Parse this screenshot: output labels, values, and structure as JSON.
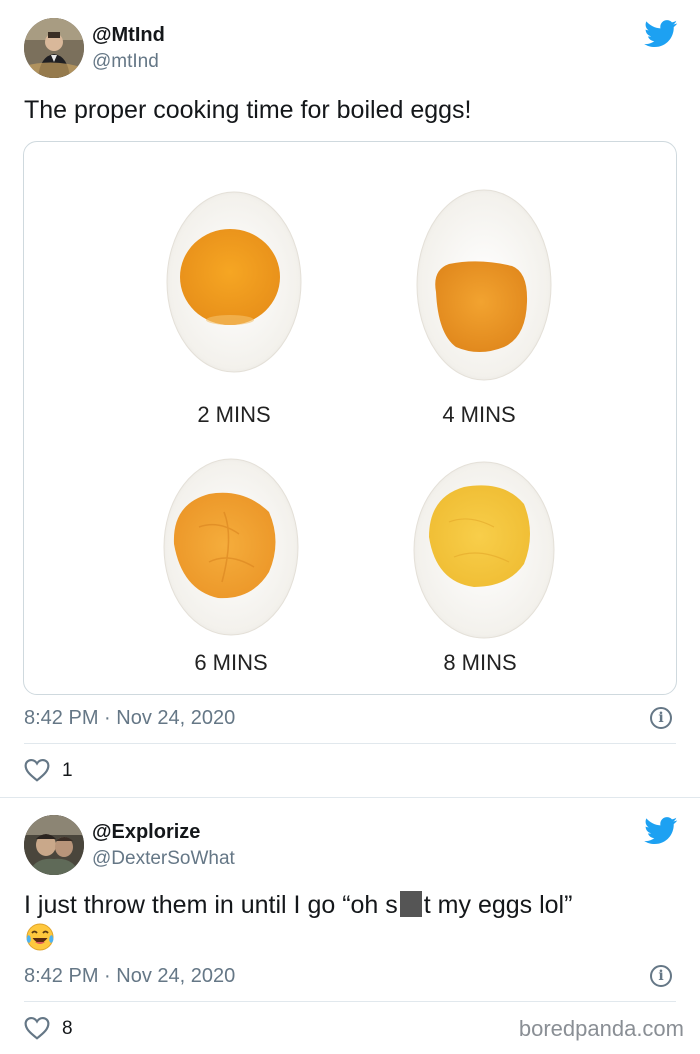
{
  "tweet1": {
    "display_name": "@MtInd",
    "handle": "@mtInd",
    "text": "The proper cooking time for boiled eggs!",
    "image": {
      "labels": [
        "2 MINS",
        "4 MINS",
        "6 MINS",
        "8 MINS"
      ]
    },
    "timestamp": "8:42 PM · Nov 24, 2020",
    "likes": "1"
  },
  "tweet2": {
    "display_name": "@Explorize",
    "handle": "@DexterSoWhat",
    "text_before": "I just throw them in until I go “oh s",
    "text_after": "t my eggs lol”",
    "emoji": "face-with-tears-of-joy",
    "timestamp": "8:42 PM · Nov 24, 2020",
    "likes": "8"
  },
  "watermark": "boredpanda.com",
  "colors": {
    "twitter_blue": "#1da1f2",
    "text_primary": "#14171a",
    "text_secondary": "#657786",
    "border": "#cfd9de"
  }
}
